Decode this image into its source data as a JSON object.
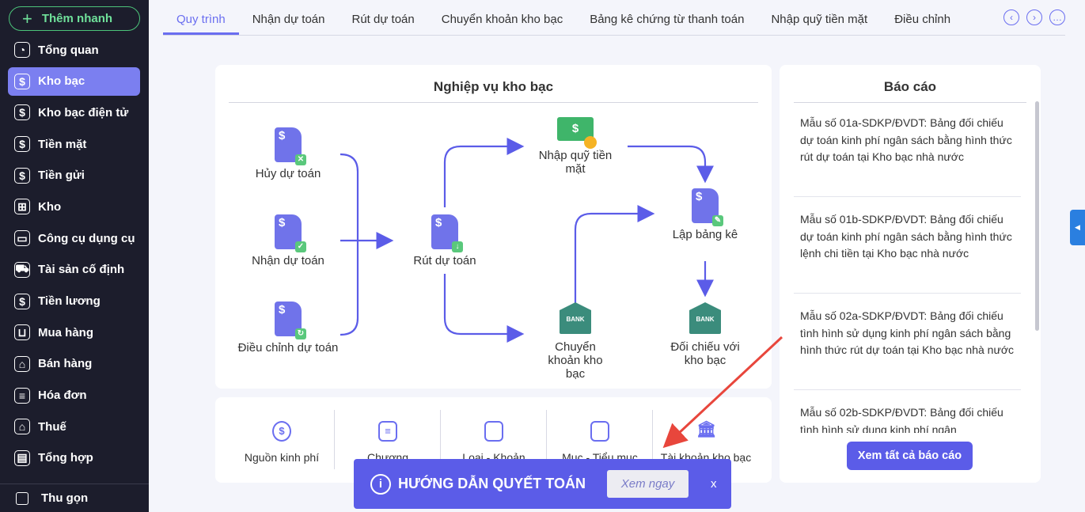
{
  "sidebar": {
    "quick_add": "Thêm nhanh",
    "items": [
      {
        "label": "Tổng quan",
        "icon": "pie-chart-icon"
      },
      {
        "label": "Kho bạc",
        "icon": "treasury-icon",
        "active": true
      },
      {
        "label": "Kho bạc điện tử",
        "icon": "e-treasury-icon"
      },
      {
        "label": "Tiền mặt",
        "icon": "cash-icon"
      },
      {
        "label": "Tiền gửi",
        "icon": "deposit-icon"
      },
      {
        "label": "Kho",
        "icon": "warehouse-icon"
      },
      {
        "label": "Công cụ dụng cụ",
        "icon": "tools-icon"
      },
      {
        "label": "Tài sản cố định",
        "icon": "truck-icon"
      },
      {
        "label": "Tiền lương",
        "icon": "salary-icon"
      },
      {
        "label": "Mua hàng",
        "icon": "cart-icon"
      },
      {
        "label": "Bán hàng",
        "icon": "store-icon"
      },
      {
        "label": "Hóa đơn",
        "icon": "invoice-icon"
      },
      {
        "label": "Thuế",
        "icon": "bank-icon"
      },
      {
        "label": "Tổng hợp",
        "icon": "summary-icon"
      }
    ],
    "collapse": "Thu gọn"
  },
  "tabs": [
    "Quy trình",
    "Nhận dự toán",
    "Rút dự toán",
    "Chuyển khoản kho bạc",
    "Bảng kê chứng từ thanh toán",
    "Nhập quỹ tiền mặt",
    "Điều chỉnh"
  ],
  "process": {
    "title": "Nghiệp vụ kho bạc",
    "nodes": {
      "huy": "Hủy dự toán",
      "nhan": "Nhận dự toán",
      "dieu_chinh": "Điều chỉnh dự toán",
      "rut": "Rút dự toán",
      "nhap_quy": "Nhập quỹ tiền mặt",
      "lap_bang_ke": "Lập bảng kê",
      "chuyen_khoan": "Chuyển khoản kho bạc",
      "doi_chieu": "Đối chiếu với kho bạc"
    }
  },
  "categories": [
    "Nguồn kinh phí",
    "Chương",
    "Loại - Khoản",
    "Mục - Tiểu mục",
    "Tài khoản kho bạc"
  ],
  "reports": {
    "title": "Báo cáo",
    "items": [
      "Mẫu số 01a-SDKP/ĐVDT: Bảng đối chiếu dự toán kinh phí ngân sách bằng hình thức rút dự toán tại Kho bạc nhà nước",
      "Mẫu số 01b-SDKP/ĐVDT: Bảng đối chiếu dự toán kinh phí ngân sách bằng hình thức lệnh chi tiền tại Kho bạc nhà nước",
      "Mẫu số 02a-SDKP/ĐVDT: Bảng đối chiếu tình hình sử dụng kinh phí ngân sách bằng hình thức rút dự toán tại Kho bạc nhà nước",
      "Mẫu số 02b-SDKP/ĐVDT: Bảng đối chiếu tình hình sử dụng kinh phí ngân"
    ],
    "view_all": "Xem tất cả báo cáo"
  },
  "toast": {
    "title": "HƯỚNG DẪN QUYẾT TOÁN",
    "action": "Xem ngay",
    "close": "x"
  },
  "colors": {
    "accent": "#5b5ce8",
    "sidebar": "#1c1d2c",
    "annotation": "#e8463c"
  }
}
